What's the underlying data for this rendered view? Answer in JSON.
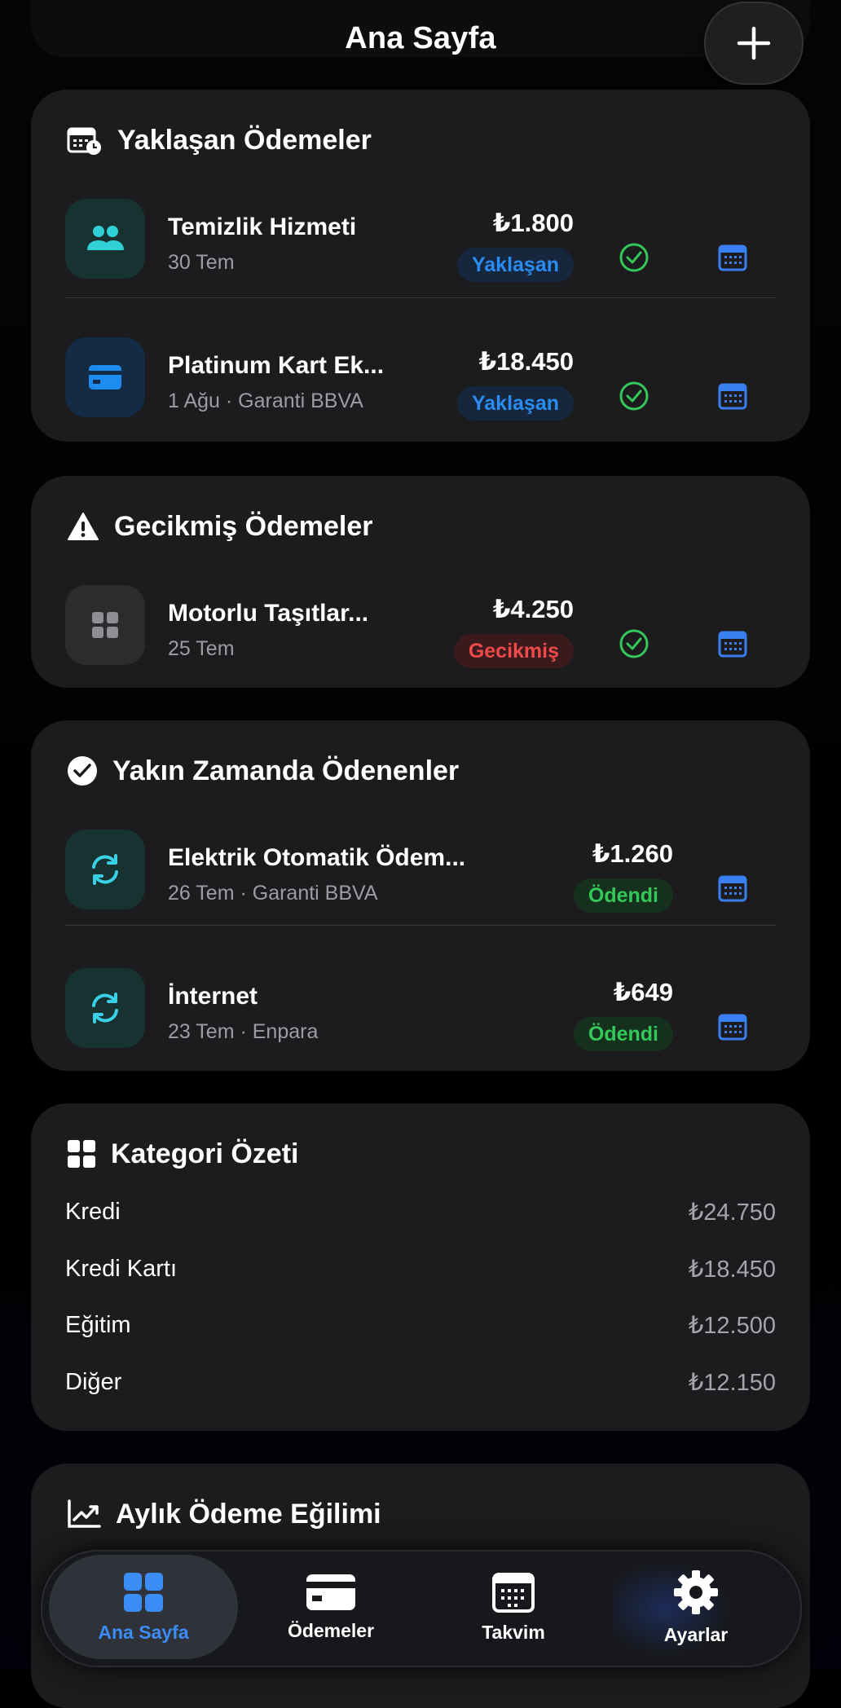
{
  "header": {
    "title": "Ana Sayfa",
    "add_icon": "plus-icon"
  },
  "colors": {
    "accent_blue": "#2a8cf0",
    "overdue_red": "#ee4a4a",
    "paid_green": "#34c759",
    "card_bg": "#1c1c1e"
  },
  "upcoming": {
    "title": "Yaklaşan Ödemeler",
    "icon": "calendar-clock-icon",
    "items": [
      {
        "name": "Temizlik Hizmeti",
        "sub": "30 Tem",
        "amount": "₺1.800",
        "status": "Yaklaşan",
        "icon": "people-icon"
      },
      {
        "name": "Platinum Kart Ek...",
        "sub": "1 Ağu · Garanti BBVA",
        "amount": "₺18.450",
        "status": "Yaklaşan",
        "icon": "credit-card-icon"
      }
    ]
  },
  "overdue": {
    "title": "Gecikmiş Ödemeler",
    "icon": "warning-icon",
    "items": [
      {
        "name": "Motorlu Taşıtlar...",
        "sub": "25 Tem",
        "amount": "₺4.250",
        "status": "Gecikmiş",
        "icon": "grid-icon"
      }
    ]
  },
  "paid": {
    "title": "Yakın Zamanda Ödenenler",
    "icon": "checkmark-circle-icon",
    "items": [
      {
        "name": "Elektrik Otomatik Ödem...",
        "sub": "26 Tem · Garanti BBVA",
        "amount": "₺1.260",
        "status": "Ödendi",
        "extra": "∑",
        "icon": "refresh-icon"
      },
      {
        "name": "İnternet",
        "sub": "23 Tem · Enpara",
        "amount": "₺649",
        "status": "Ödendi",
        "icon": "refresh-icon"
      }
    ]
  },
  "category_summary": {
    "title": "Kategori Özeti",
    "icon": "grid-icon",
    "rows": [
      {
        "label": "Kredi",
        "value": "₺24.750"
      },
      {
        "label": "Kredi Kartı",
        "value": "₺18.450"
      },
      {
        "label": "Eğitim",
        "value": "₺12.500"
      },
      {
        "label": "Diğer",
        "value": "₺12.150"
      }
    ]
  },
  "monthly_trend": {
    "title": "Aylık Ödeme Eğilimi",
    "icon": "trend-chart-icon"
  },
  "tabbar": {
    "tabs": [
      {
        "label": "Ana Sayfa",
        "icon": "home-grid-icon",
        "active": true
      },
      {
        "label": "Ödemeler",
        "icon": "credit-card-icon",
        "active": false
      },
      {
        "label": "Takvim",
        "icon": "calendar-icon",
        "active": false
      },
      {
        "label": "Ayarlar",
        "icon": "gear-icon",
        "active": false
      }
    ]
  }
}
